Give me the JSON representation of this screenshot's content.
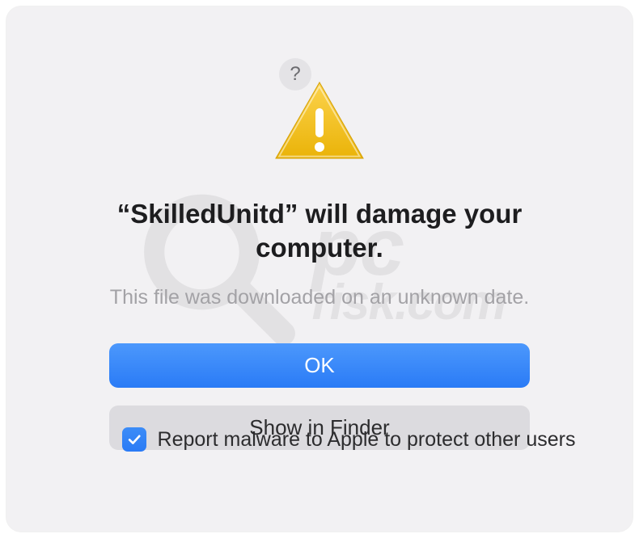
{
  "dialog": {
    "help_label": "?",
    "title": "“SkilledUnitd” will damage your computer.",
    "subtitle": "This file was downloaded on an unknown date.",
    "buttons": {
      "ok": "OK",
      "show_finder": "Show in Finder"
    },
    "checkbox": {
      "checked": true,
      "label": "Report malware to Apple to protect other users"
    }
  },
  "watermark": {
    "text_top": "pc",
    "text_bottom": "risk.com"
  }
}
